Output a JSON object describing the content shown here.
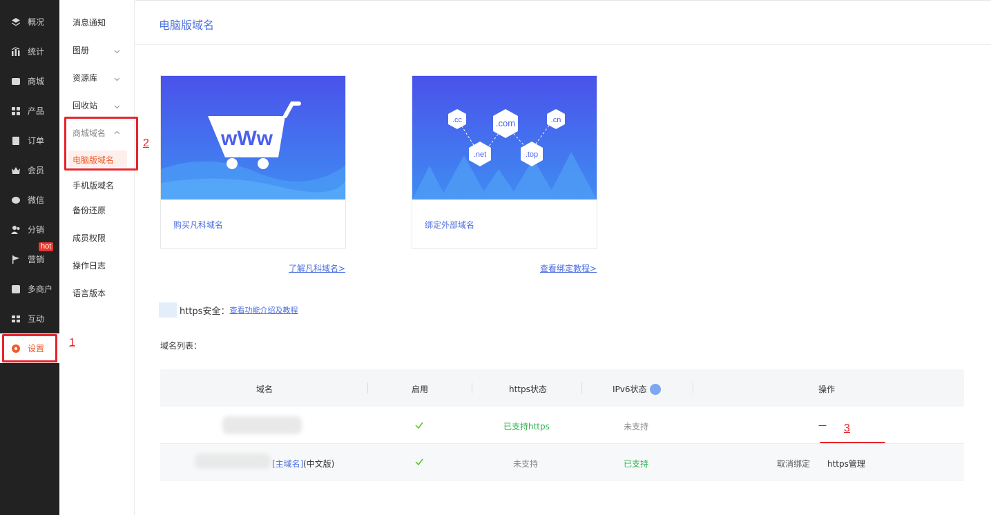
{
  "sidebar": {
    "items": [
      {
        "label": "概况",
        "icon": "layers-icon"
      },
      {
        "label": "统计",
        "icon": "chart-icon"
      },
      {
        "label": "商城",
        "icon": "store-icon"
      },
      {
        "label": "产品",
        "icon": "grid-icon"
      },
      {
        "label": "订单",
        "icon": "clipboard-icon"
      },
      {
        "label": "会员",
        "icon": "crown-icon"
      },
      {
        "label": "微信",
        "icon": "wechat-icon"
      },
      {
        "label": "分销",
        "icon": "users-icon"
      },
      {
        "label": "营销",
        "icon": "flag-icon"
      },
      {
        "label": "多商户",
        "icon": "merchant-icon"
      },
      {
        "label": "互动",
        "icon": "interact-icon"
      },
      {
        "label": "设置",
        "icon": "gear-icon"
      }
    ],
    "hot_badge": "hot"
  },
  "subnav": {
    "items": [
      "消息通知",
      "图册",
      "资源库",
      "回收站",
      "商城域名",
      "电脑版域名",
      "手机版域名",
      "备份还原",
      "成员权限",
      "操作日志",
      "语言版本"
    ]
  },
  "annotations": [
    "1",
    "2",
    "3"
  ],
  "page": {
    "title": "电脑版域名"
  },
  "cards": [
    {
      "label": "购买凡科域名",
      "link": "了解凡科域名>",
      "banner_text": "wWw"
    },
    {
      "label": "绑定外部域名",
      "link": "查看绑定教程>",
      "tlds": [
        ".cc",
        ".com",
        ".cn",
        ".net",
        ".top"
      ]
    }
  ],
  "https": {
    "label": "https安全：",
    "link": "查看功能介绍及教程"
  },
  "list_label": "域名列表：",
  "table": {
    "headers": [
      "域名",
      "启用",
      "https状态",
      "IPv6状态",
      "操作"
    ],
    "rows": [
      {
        "https": "已支持https",
        "ipv6": "未支持",
        "action": "—"
      },
      {
        "domain_suffix": "[主域名]",
        "domain_version": "(中文版)",
        "https": "未支持",
        "ipv6": "已支持",
        "cancel": "取消绑定",
        "manage": "https管理"
      }
    ]
  },
  "colors": {
    "accent": "#f05a28",
    "link": "#4a6ee0",
    "green": "#2db24f",
    "annotation": "#e8232b"
  }
}
